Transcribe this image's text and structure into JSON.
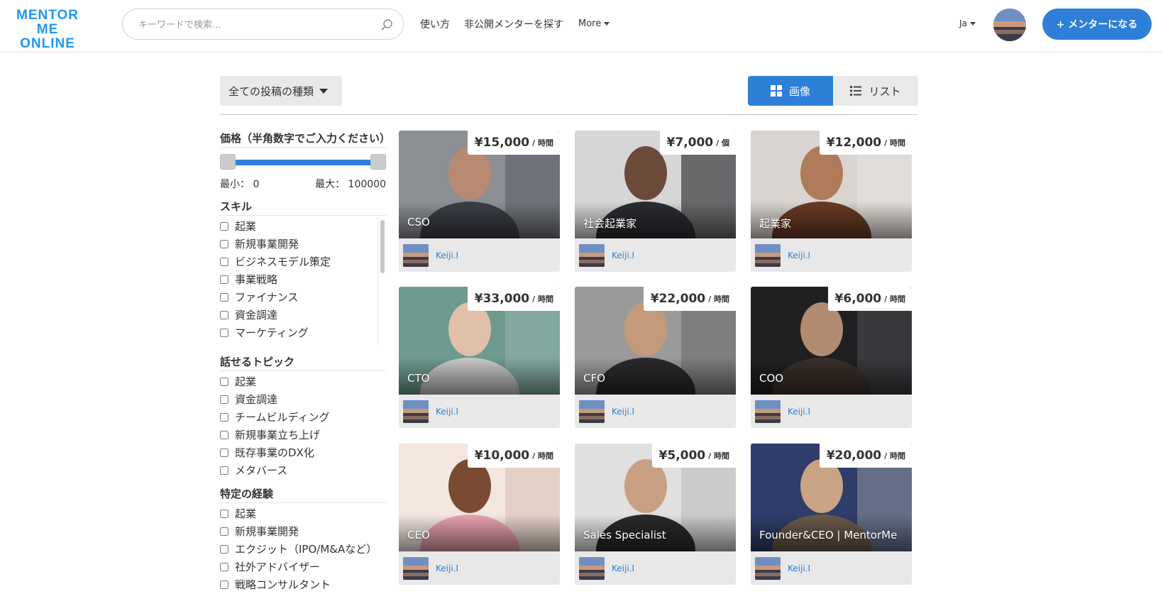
{
  "header": {
    "logo_line1": "MENTOR ME",
    "logo_line2": "ONLINE",
    "search_placeholder": "キーワードで検索...",
    "nav": [
      "使い方",
      "非公開メンターを探す"
    ],
    "more_label": "More",
    "lang_label": "Ja",
    "cta_label": "+ メンターになる"
  },
  "toolbar": {
    "type_filter_label": "全ての投稿の種類",
    "view_image_label": "画像",
    "view_list_label": "リスト"
  },
  "sidebar": {
    "price_title": "価格（半角数字でご入力ください）",
    "min_label": "最小：",
    "min_value": "0",
    "max_label": "最大：",
    "max_value": "100000",
    "skills_title": "スキル",
    "skills": [
      "起業",
      "新規事業開発",
      "ビジネスモデル策定",
      "事業戦略",
      "ファイナンス",
      "資金調達",
      "マーケティング"
    ],
    "topics_title": "話せるトピック",
    "topics": [
      "起業",
      "資金調達",
      "チームビルディング",
      "新規事業立ち上げ",
      "既存事業のDX化",
      "メタバース"
    ],
    "experience_title": "特定の経験",
    "experience": [
      "起業",
      "新規事業開発",
      "エクジット（IPO/M&Aなど）",
      "社外アドバイザー",
      "戦略コンサルタント"
    ]
  },
  "cards": [
    {
      "title": "CSO",
      "price": "¥15,000",
      "unit": "/ 時間",
      "author": "Keiji.I"
    },
    {
      "title": "社会起業家",
      "price": "¥7,000",
      "unit": "/ 個",
      "author": "Keiji.I"
    },
    {
      "title": "起業家",
      "price": "¥12,000",
      "unit": "/ 時間",
      "author": "Keiji.I"
    },
    {
      "title": "CTO",
      "price": "¥33,000",
      "unit": "/ 時間",
      "author": "Keiji.I"
    },
    {
      "title": "CFO",
      "price": "¥22,000",
      "unit": "/ 時間",
      "author": "Keiji.I"
    },
    {
      "title": "COO",
      "price": "¥6,000",
      "unit": "/ 時間",
      "author": "Keiji.I"
    },
    {
      "title": "CEO",
      "price": "¥10,000",
      "unit": "/ 時間",
      "author": "Keiji.I"
    },
    {
      "title": "Sales Specialist",
      "price": "¥5,000",
      "unit": "/ 時間",
      "author": "Keiji.I"
    },
    {
      "title": "Founder&CEO | MentorMe",
      "price": "¥20,000",
      "unit": "/ 時間",
      "author": "Keiji.I"
    }
  ]
}
